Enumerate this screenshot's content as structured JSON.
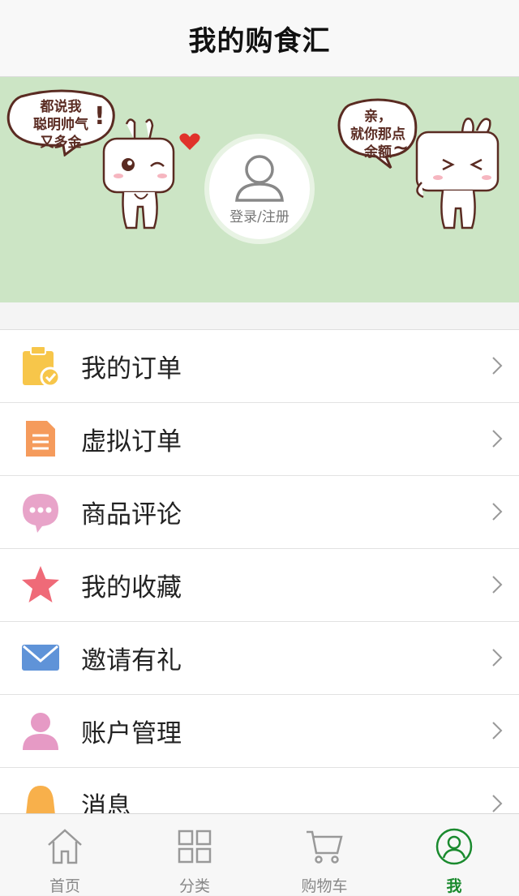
{
  "header": {
    "title": "我的购食汇"
  },
  "banner": {
    "left_bubble": "都说我\n聪明帅气\n又多金",
    "left_exclaim": "!",
    "right_bubble": "亲，\n就你那点\n余额",
    "right_tilde": "~",
    "login_label": "登录/注册",
    "background": "#cce5c5"
  },
  "menu": {
    "items": [
      {
        "label": "我的订单",
        "icon": "clipboard-check-icon",
        "color": "#f7c64a"
      },
      {
        "label": "虚拟订单",
        "icon": "document-icon",
        "color": "#f59b5c"
      },
      {
        "label": "商品评论",
        "icon": "chat-bubble-icon",
        "color": "#e8a4c9"
      },
      {
        "label": "我的收藏",
        "icon": "star-icon",
        "color": "#ef6a78"
      },
      {
        "label": "邀请有礼",
        "icon": "envelope-icon",
        "color": "#5f93d8"
      },
      {
        "label": "账户管理",
        "icon": "user-icon",
        "color": "#e69ac5"
      },
      {
        "label": "消息",
        "icon": "bell-icon",
        "color": "#f8b04b"
      }
    ]
  },
  "tabbar": {
    "tabs": [
      {
        "label": "首页",
        "icon": "home-icon"
      },
      {
        "label": "分类",
        "icon": "grid-icon"
      },
      {
        "label": "购物车",
        "icon": "cart-icon"
      },
      {
        "label": "我",
        "icon": "profile-icon",
        "active": true
      }
    ],
    "active_color": "#1a8a2e"
  }
}
